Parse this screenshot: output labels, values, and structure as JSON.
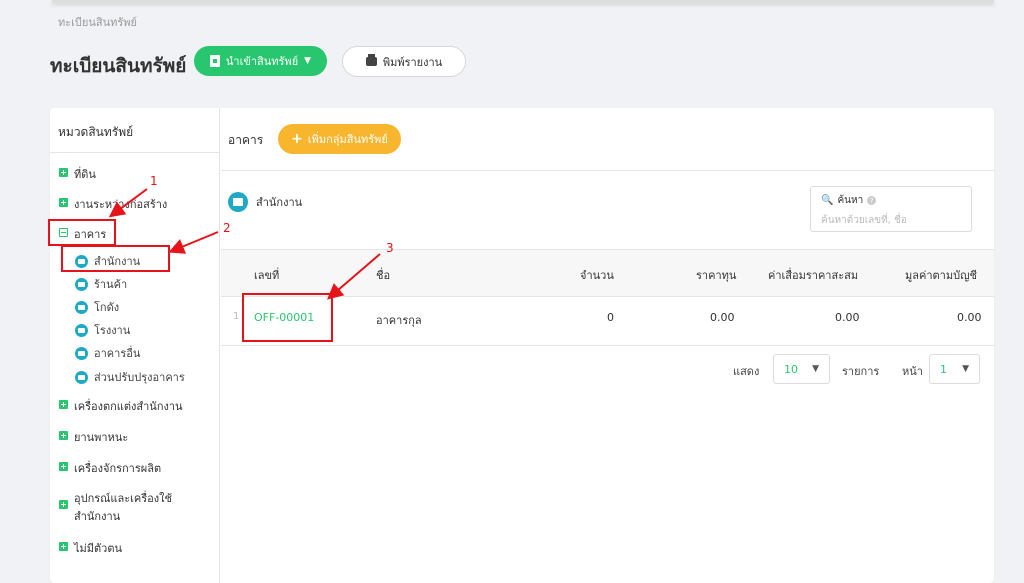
{
  "breadcrumb": "ทะเบียนสินทรัพย์",
  "page_title": "ทะเบียนสินทรัพย์",
  "toolbar": {
    "import_label": "นำเข้าสินทรัพย์",
    "print_label": "พิมพ์รายงาน"
  },
  "sidebar": {
    "title": "หมวดสินทรัพย์",
    "categories": [
      {
        "label": "ที่ดิน"
      },
      {
        "label": "งานระหว่างก่อสร้าง"
      },
      {
        "label": "อาคาร"
      },
      {
        "label": "เครื่องตกแต่งสำนักงาน"
      },
      {
        "label": "ยานพาหนะ"
      },
      {
        "label": "เครื่องจักรการผลิต"
      },
      {
        "label": "อุปกรณ์และเครื่องใช้"
      },
      {
        "label": "สำนักงาน"
      },
      {
        "label": "ไม่มีตัวตน"
      }
    ],
    "building_items": [
      {
        "label": "สำนักงาน"
      },
      {
        "label": "ร้านค้า"
      },
      {
        "label": "โกดัง"
      },
      {
        "label": "โรงงาน"
      },
      {
        "label": "อาคารอื่น"
      },
      {
        "label": "ส่วนปรับปรุงอาคาร"
      }
    ]
  },
  "content": {
    "group_name": "อาคาร",
    "add_group_label": "เพิ่มกลุ่มสินทรัพย์",
    "subgroup_title": "สำนักงาน",
    "search": {
      "label": "ค้นหา",
      "placeholder": "ค้นหาด้วยเลขที่, ชื่อ"
    },
    "table": {
      "columns": [
        "เลขที่",
        "ชื่อ",
        "จำนวน",
        "ราคาทุน",
        "ค่าเสื่อมราคาสะสม",
        "มูลค่าตามบัญชี"
      ],
      "rows": [
        {
          "index": "1",
          "code": "OFF-00001",
          "name": "อาคารกุล",
          "qty": "0",
          "cost": "0.00",
          "depreciation": "0.00",
          "book_value": "0.00"
        }
      ]
    },
    "pager": {
      "show_label": "แสดง",
      "per_page": "10",
      "items_label": "รายการ",
      "page_label": "หน้า",
      "page": "1"
    }
  },
  "annotations": [
    "1",
    "2",
    "3"
  ],
  "colors": {
    "primary_green": "#28c76f",
    "accent_orange": "#f8b52e",
    "icon_teal": "#1fa9c4",
    "annotation_red": "#e6131a"
  }
}
